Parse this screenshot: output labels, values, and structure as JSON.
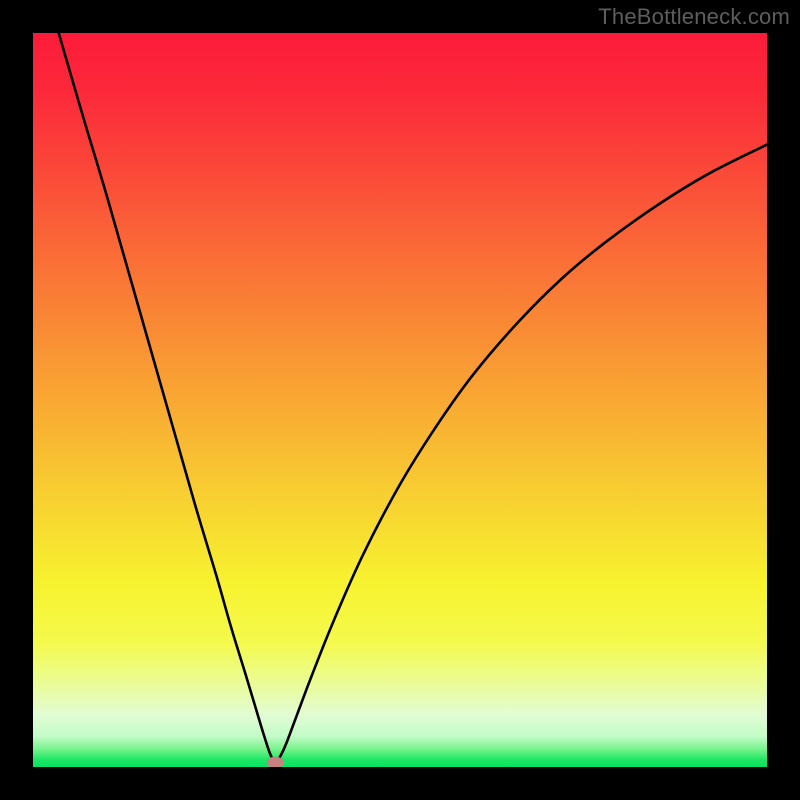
{
  "watermark": "TheBottleneck.com",
  "chart_data": {
    "type": "line",
    "title": "",
    "xlabel": "",
    "ylabel": "",
    "xlim": [
      0,
      100
    ],
    "ylim": [
      0,
      100
    ],
    "min_x": 33,
    "curve_points": [
      {
        "x": 3.5,
        "y": 100
      },
      {
        "x": 7,
        "y": 88
      },
      {
        "x": 10,
        "y": 78
      },
      {
        "x": 14,
        "y": 64
      },
      {
        "x": 18,
        "y": 50
      },
      {
        "x": 22,
        "y": 36
      },
      {
        "x": 25,
        "y": 26
      },
      {
        "x": 27,
        "y": 19
      },
      {
        "x": 29,
        "y": 12.5
      },
      {
        "x": 30.5,
        "y": 7.5
      },
      {
        "x": 31.5,
        "y": 4.2
      },
      {
        "x": 32.3,
        "y": 1.8
      },
      {
        "x": 33,
        "y": 0.6
      },
      {
        "x": 33.6,
        "y": 1.3
      },
      {
        "x": 34.5,
        "y": 3.2
      },
      {
        "x": 36,
        "y": 7.2
      },
      {
        "x": 38,
        "y": 12.5
      },
      {
        "x": 41,
        "y": 20
      },
      {
        "x": 45,
        "y": 29
      },
      {
        "x": 50,
        "y": 38.5
      },
      {
        "x": 55,
        "y": 46.5
      },
      {
        "x": 60,
        "y": 53.5
      },
      {
        "x": 66,
        "y": 60.5
      },
      {
        "x": 72,
        "y": 66.5
      },
      {
        "x": 78,
        "y": 71.5
      },
      {
        "x": 85,
        "y": 76.5
      },
      {
        "x": 92,
        "y": 80.8
      },
      {
        "x": 100,
        "y": 84.8
      }
    ],
    "marker": {
      "x": 33,
      "y": 0.6,
      "color": "#c78180"
    },
    "gradient_stops": [
      {
        "offset": 0.0,
        "color": "#fc1b3a"
      },
      {
        "offset": 0.08,
        "color": "#fc293a"
      },
      {
        "offset": 0.18,
        "color": "#fb4639"
      },
      {
        "offset": 0.28,
        "color": "#fa6537"
      },
      {
        "offset": 0.38,
        "color": "#f98435"
      },
      {
        "offset": 0.48,
        "color": "#f9a233"
      },
      {
        "offset": 0.58,
        "color": "#f8c032"
      },
      {
        "offset": 0.68,
        "color": "#f7de30"
      },
      {
        "offset": 0.75,
        "color": "#f7f22f"
      },
      {
        "offset": 0.83,
        "color": "#f4fa4c"
      },
      {
        "offset": 0.88,
        "color": "#ecfc8e"
      },
      {
        "offset": 0.93,
        "color": "#e1fcd5"
      },
      {
        "offset": 0.958,
        "color": "#c3fbc7"
      },
      {
        "offset": 0.975,
        "color": "#7af48e"
      },
      {
        "offset": 0.99,
        "color": "#1de765"
      },
      {
        "offset": 1.0,
        "color": "#04e360"
      }
    ],
    "annotations": []
  }
}
